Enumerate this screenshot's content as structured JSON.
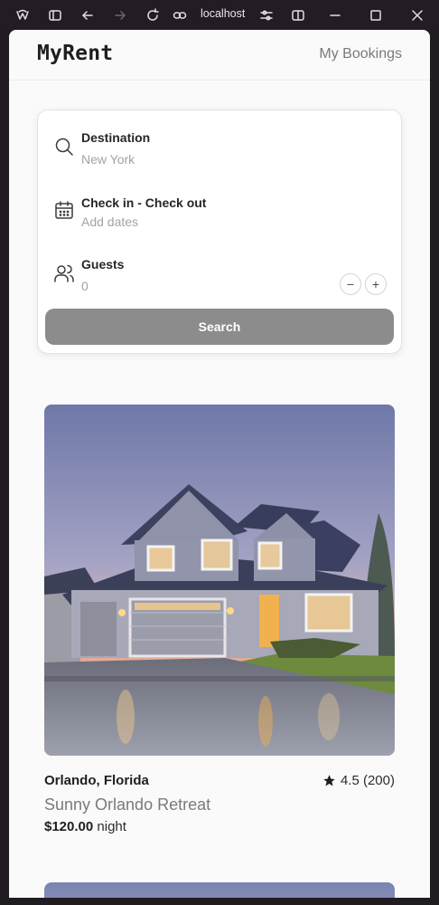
{
  "browser": {
    "url": "localhost"
  },
  "navbar": {
    "logo": "MyRent",
    "bookings_link": "My Bookings"
  },
  "search": {
    "destination_label": "Destination",
    "destination_value": "New York",
    "dates_label": "Check in - Check out",
    "dates_placeholder": "Add dates",
    "guests_label": "Guests",
    "guests_value": "0",
    "decrement": "−",
    "increment": "+",
    "button_label": "Search"
  },
  "listings": [
    {
      "location": "Orlando, Florida",
      "rating": "4.5 (200)",
      "title": "Sunny Orlando Retreat",
      "price": "$120.00",
      "price_unit": "night"
    }
  ],
  "colors": {
    "search_button": "#8c8c8c",
    "page_background": "#fafafa",
    "browser_frame": "#231c24"
  }
}
